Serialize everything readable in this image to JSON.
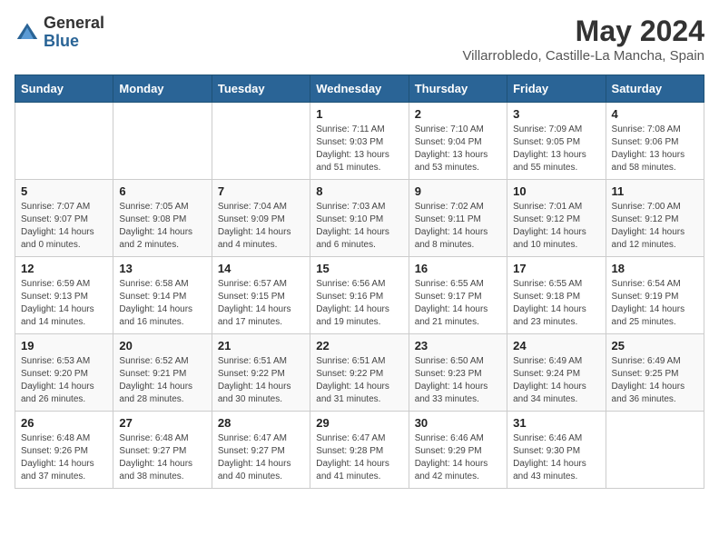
{
  "header": {
    "logo_general": "General",
    "logo_blue": "Blue",
    "month_year": "May 2024",
    "location": "Villarrobledo, Castille-La Mancha, Spain"
  },
  "days_of_week": [
    "Sunday",
    "Monday",
    "Tuesday",
    "Wednesday",
    "Thursday",
    "Friday",
    "Saturday"
  ],
  "weeks": [
    [
      {
        "day": "",
        "info": ""
      },
      {
        "day": "",
        "info": ""
      },
      {
        "day": "",
        "info": ""
      },
      {
        "day": "1",
        "info": "Sunrise: 7:11 AM\nSunset: 9:03 PM\nDaylight: 13 hours\nand 51 minutes."
      },
      {
        "day": "2",
        "info": "Sunrise: 7:10 AM\nSunset: 9:04 PM\nDaylight: 13 hours\nand 53 minutes."
      },
      {
        "day": "3",
        "info": "Sunrise: 7:09 AM\nSunset: 9:05 PM\nDaylight: 13 hours\nand 55 minutes."
      },
      {
        "day": "4",
        "info": "Sunrise: 7:08 AM\nSunset: 9:06 PM\nDaylight: 13 hours\nand 58 minutes."
      }
    ],
    [
      {
        "day": "5",
        "info": "Sunrise: 7:07 AM\nSunset: 9:07 PM\nDaylight: 14 hours\nand 0 minutes."
      },
      {
        "day": "6",
        "info": "Sunrise: 7:05 AM\nSunset: 9:08 PM\nDaylight: 14 hours\nand 2 minutes."
      },
      {
        "day": "7",
        "info": "Sunrise: 7:04 AM\nSunset: 9:09 PM\nDaylight: 14 hours\nand 4 minutes."
      },
      {
        "day": "8",
        "info": "Sunrise: 7:03 AM\nSunset: 9:10 PM\nDaylight: 14 hours\nand 6 minutes."
      },
      {
        "day": "9",
        "info": "Sunrise: 7:02 AM\nSunset: 9:11 PM\nDaylight: 14 hours\nand 8 minutes."
      },
      {
        "day": "10",
        "info": "Sunrise: 7:01 AM\nSunset: 9:12 PM\nDaylight: 14 hours\nand 10 minutes."
      },
      {
        "day": "11",
        "info": "Sunrise: 7:00 AM\nSunset: 9:12 PM\nDaylight: 14 hours\nand 12 minutes."
      }
    ],
    [
      {
        "day": "12",
        "info": "Sunrise: 6:59 AM\nSunset: 9:13 PM\nDaylight: 14 hours\nand 14 minutes."
      },
      {
        "day": "13",
        "info": "Sunrise: 6:58 AM\nSunset: 9:14 PM\nDaylight: 14 hours\nand 16 minutes."
      },
      {
        "day": "14",
        "info": "Sunrise: 6:57 AM\nSunset: 9:15 PM\nDaylight: 14 hours\nand 17 minutes."
      },
      {
        "day": "15",
        "info": "Sunrise: 6:56 AM\nSunset: 9:16 PM\nDaylight: 14 hours\nand 19 minutes."
      },
      {
        "day": "16",
        "info": "Sunrise: 6:55 AM\nSunset: 9:17 PM\nDaylight: 14 hours\nand 21 minutes."
      },
      {
        "day": "17",
        "info": "Sunrise: 6:55 AM\nSunset: 9:18 PM\nDaylight: 14 hours\nand 23 minutes."
      },
      {
        "day": "18",
        "info": "Sunrise: 6:54 AM\nSunset: 9:19 PM\nDaylight: 14 hours\nand 25 minutes."
      }
    ],
    [
      {
        "day": "19",
        "info": "Sunrise: 6:53 AM\nSunset: 9:20 PM\nDaylight: 14 hours\nand 26 minutes."
      },
      {
        "day": "20",
        "info": "Sunrise: 6:52 AM\nSunset: 9:21 PM\nDaylight: 14 hours\nand 28 minutes."
      },
      {
        "day": "21",
        "info": "Sunrise: 6:51 AM\nSunset: 9:22 PM\nDaylight: 14 hours\nand 30 minutes."
      },
      {
        "day": "22",
        "info": "Sunrise: 6:51 AM\nSunset: 9:22 PM\nDaylight: 14 hours\nand 31 minutes."
      },
      {
        "day": "23",
        "info": "Sunrise: 6:50 AM\nSunset: 9:23 PM\nDaylight: 14 hours\nand 33 minutes."
      },
      {
        "day": "24",
        "info": "Sunrise: 6:49 AM\nSunset: 9:24 PM\nDaylight: 14 hours\nand 34 minutes."
      },
      {
        "day": "25",
        "info": "Sunrise: 6:49 AM\nSunset: 9:25 PM\nDaylight: 14 hours\nand 36 minutes."
      }
    ],
    [
      {
        "day": "26",
        "info": "Sunrise: 6:48 AM\nSunset: 9:26 PM\nDaylight: 14 hours\nand 37 minutes."
      },
      {
        "day": "27",
        "info": "Sunrise: 6:48 AM\nSunset: 9:27 PM\nDaylight: 14 hours\nand 38 minutes."
      },
      {
        "day": "28",
        "info": "Sunrise: 6:47 AM\nSunset: 9:27 PM\nDaylight: 14 hours\nand 40 minutes."
      },
      {
        "day": "29",
        "info": "Sunrise: 6:47 AM\nSunset: 9:28 PM\nDaylight: 14 hours\nand 41 minutes."
      },
      {
        "day": "30",
        "info": "Sunrise: 6:46 AM\nSunset: 9:29 PM\nDaylight: 14 hours\nand 42 minutes."
      },
      {
        "day": "31",
        "info": "Sunrise: 6:46 AM\nSunset: 9:30 PM\nDaylight: 14 hours\nand 43 minutes."
      },
      {
        "day": "",
        "info": ""
      }
    ]
  ]
}
